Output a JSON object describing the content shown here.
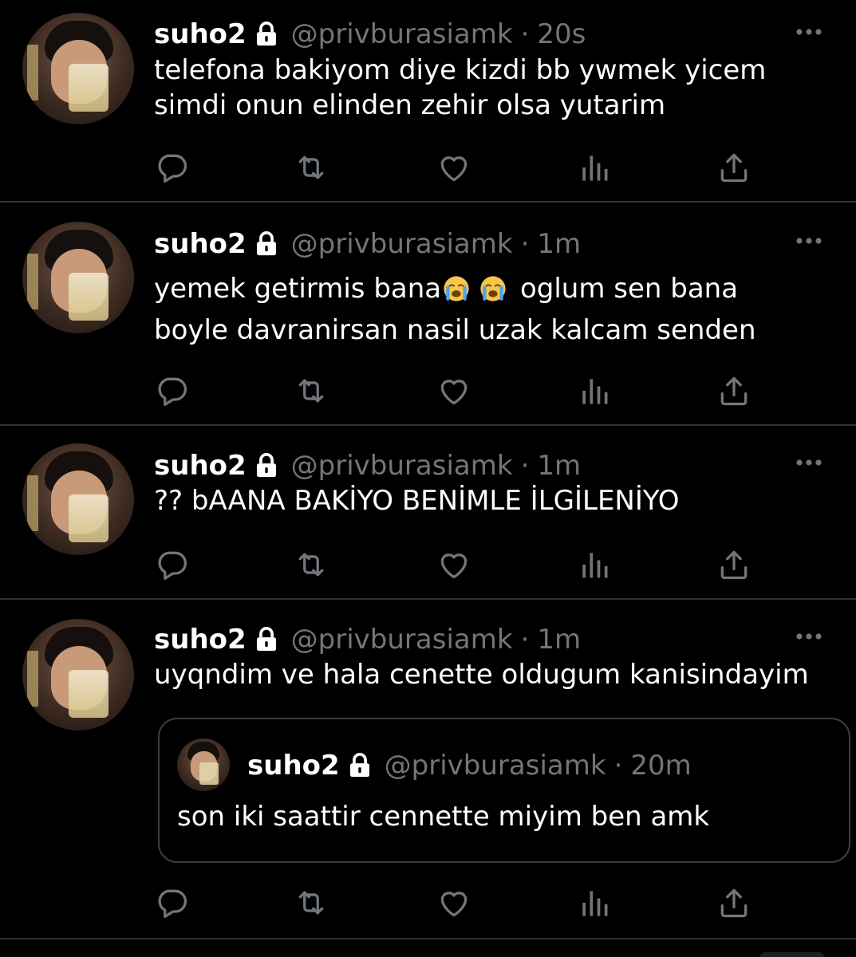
{
  "colors": {
    "background": "#000000",
    "text_primary": "#ffffff",
    "text_secondary": "#71767b",
    "divider": "#2f3336"
  },
  "tweets": [
    {
      "name": "suho2",
      "handle": "@privburasiamk",
      "separator": "·",
      "time": "20s",
      "text_lines": [
        "telefona bakiyom diye kizdi bb ywmek yicem",
        "simdi onun elinden zehir olsa yutarim"
      ]
    },
    {
      "name": "suho2",
      "handle": "@privburasiamk",
      "separator": "·",
      "time": "1m",
      "text_line1_before": "yemek getirmis bana",
      "text_line1_after": "oglum sen bana",
      "emoji_icon": "loudly-crying-face-icon",
      "text_line2": "boyle davranirsan nasil uzak kalcam senden"
    },
    {
      "name": "suho2",
      "handle": "@privburasiamk",
      "separator": "·",
      "time": "1m",
      "text_lines": [
        "?? bAANA BAKİYO BENİMLE İLGİLENİYO"
      ]
    },
    {
      "name": "suho2",
      "handle": "@privburasiamk",
      "separator": "·",
      "time": "1m",
      "text_lines": [
        "uyqndim ve hala cenette oldugum kanisindayim"
      ],
      "quote": {
        "name": "suho2",
        "handle": "@privburasiamk",
        "separator": "·",
        "time": "20m",
        "text": "son iki saattir cennette miyim ben amk"
      }
    }
  ],
  "icons": {
    "lock": "lock-icon",
    "more": "more-icon",
    "reply": "reply-icon",
    "retweet": "retweet-icon",
    "like": "like-icon",
    "views": "views-icon",
    "share": "share-icon"
  }
}
